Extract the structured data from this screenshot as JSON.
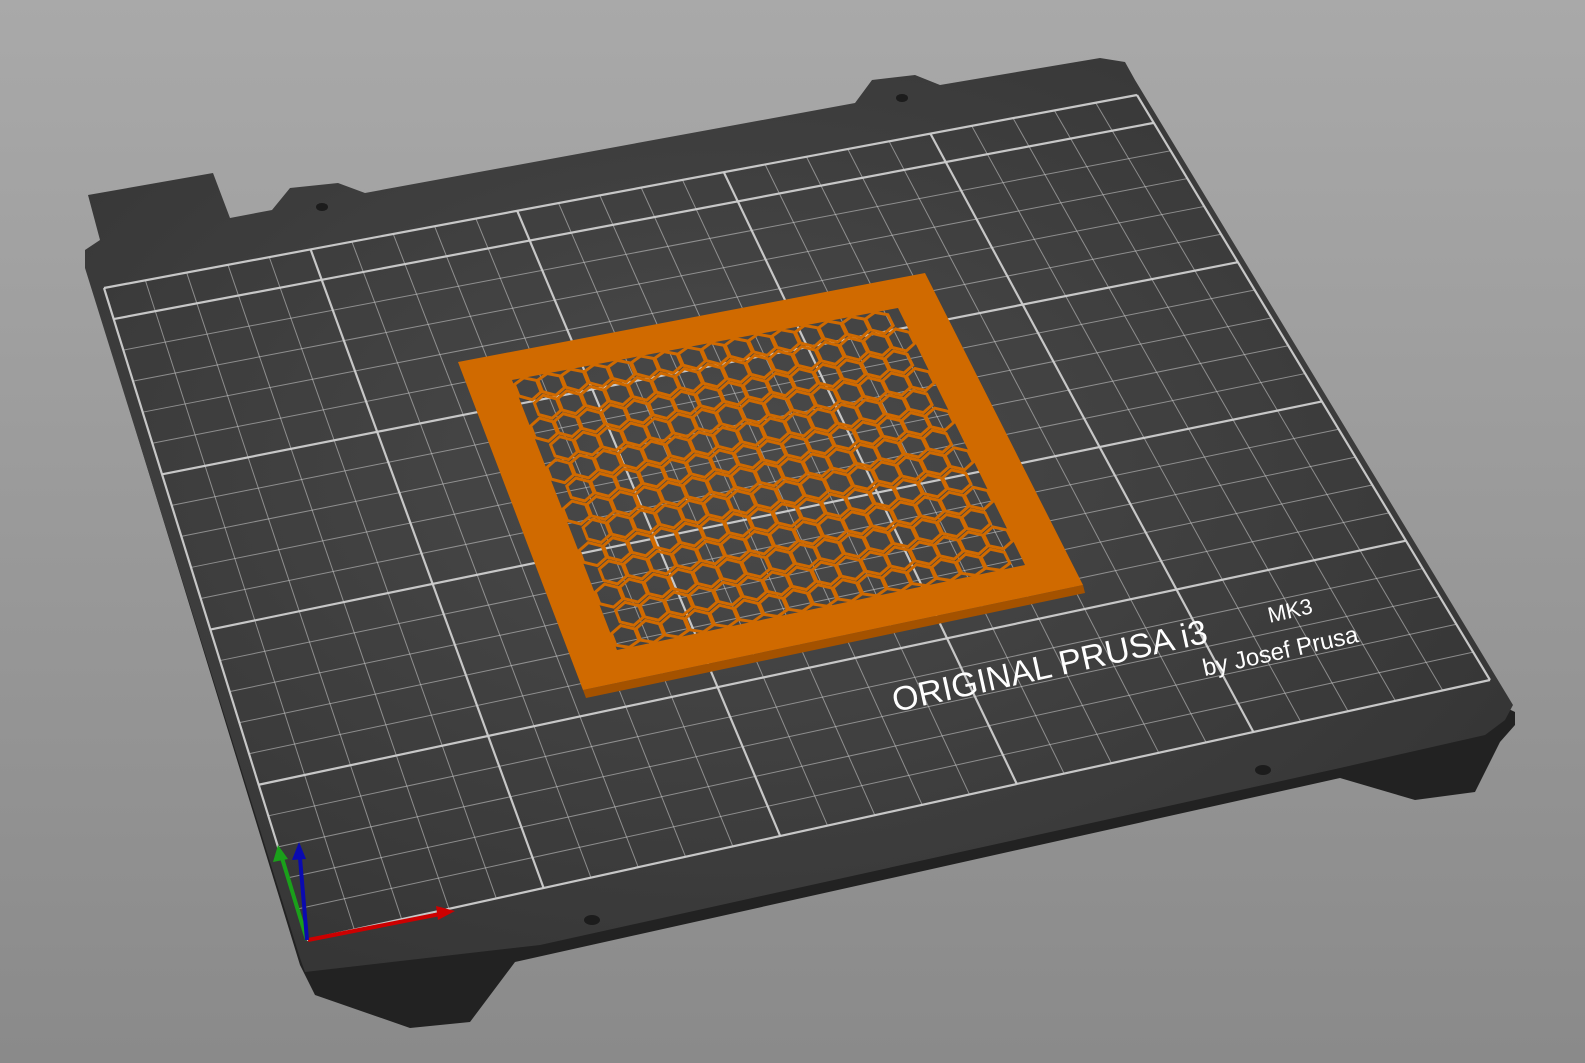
{
  "viewport": {
    "bed_logo": {
      "line1": "ORIGINAL PRUSA i3",
      "model": "MK3",
      "line2": "by Josef Prusa"
    },
    "bed_size_mm": [
      250,
      210
    ],
    "colors": {
      "background": "#999999",
      "bed": "#363636",
      "grid": "#cfcfcf",
      "object": "#d06a00",
      "axis_x": "#cc0000",
      "axis_y": "#1aa01a",
      "axis_z": "#0a0ab0"
    }
  }
}
